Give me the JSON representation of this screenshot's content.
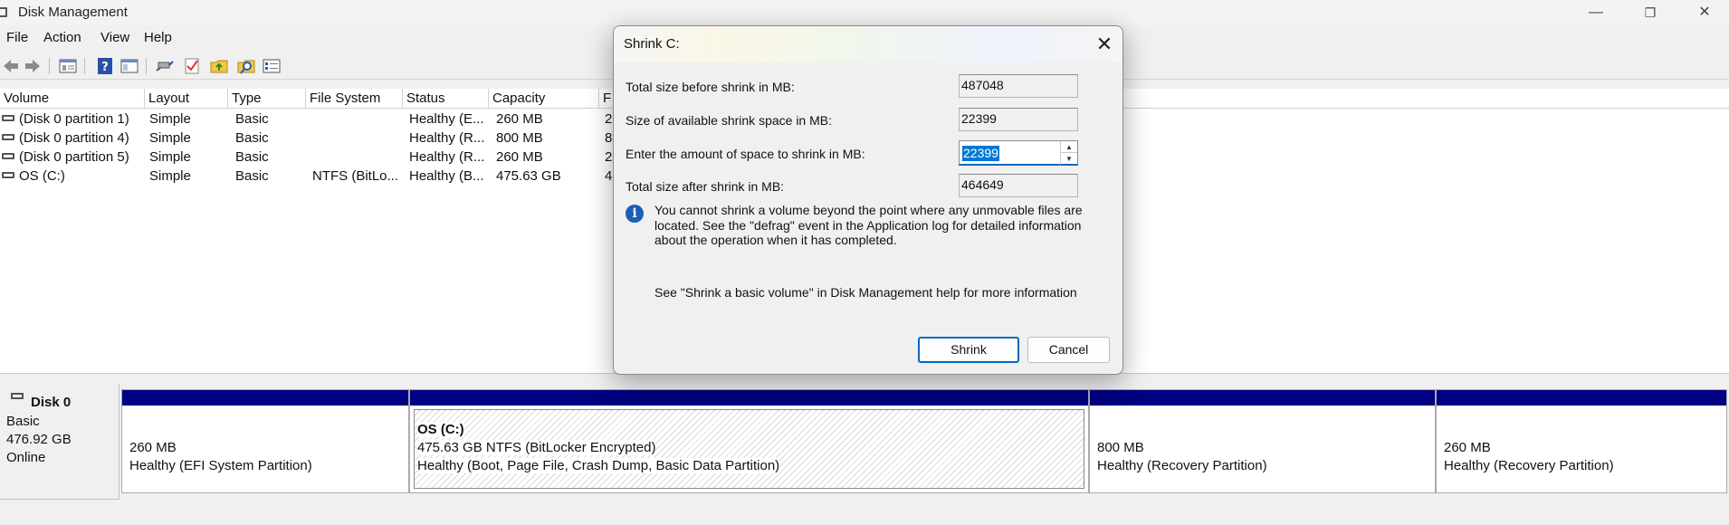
{
  "window": {
    "title": "Disk Management",
    "minimize": "—",
    "restore": "❐",
    "close": "✕"
  },
  "menu": {
    "items": [
      "File",
      "Action",
      "View",
      "Help"
    ]
  },
  "toolbar": {
    "icons": [
      "back-arrow-icon",
      "forward-arrow-icon",
      "properties-list-icon",
      "help-icon",
      "console-tree-icon",
      "connect-icon",
      "check-icon",
      "folder-up-icon",
      "search-folder-icon",
      "settings-list-icon"
    ]
  },
  "volume_list": {
    "columns": [
      "Volume",
      "Layout",
      "Type",
      "File System",
      "Status",
      "Capacity",
      "F"
    ],
    "rows": [
      {
        "volume": "(Disk 0 partition 1)",
        "layout": "Simple",
        "type": "Basic",
        "fs": "",
        "status": "Healthy (E...",
        "capacity": "260 MB",
        "free": "2"
      },
      {
        "volume": "(Disk 0 partition 4)",
        "layout": "Simple",
        "type": "Basic",
        "fs": "",
        "status": "Healthy (R...",
        "capacity": "800 MB",
        "free": "8"
      },
      {
        "volume": "(Disk 0 partition 5)",
        "layout": "Simple",
        "type": "Basic",
        "fs": "",
        "status": "Healthy (R...",
        "capacity": "260 MB",
        "free": "2"
      },
      {
        "volume": "OS (C:)",
        "layout": "Simple",
        "type": "Basic",
        "fs": "NTFS (BitLo...",
        "status": "Healthy (B...",
        "capacity": "475.63 GB",
        "free": "4"
      }
    ]
  },
  "disk": {
    "name": "Disk 0",
    "kind": "Basic",
    "size": "476.92 GB",
    "state": "Online",
    "partitions": [
      {
        "title": "",
        "line1": "260 MB",
        "line2": "Healthy (EFI System Partition)"
      },
      {
        "title": "OS  (C:)",
        "line1": "475.63 GB NTFS (BitLocker Encrypted)",
        "line2": "Healthy (Boot, Page File, Crash Dump, Basic Data Partition)"
      },
      {
        "title": "",
        "line1": "800 MB",
        "line2": "Healthy (Recovery Partition)"
      },
      {
        "title": "",
        "line1": "260 MB",
        "line2": "Healthy (Recovery Partition)"
      }
    ]
  },
  "dialog": {
    "title": "Shrink C:",
    "close": "✕",
    "labels": {
      "total_before": "Total size before shrink in MB:",
      "available": "Size of available shrink space in MB:",
      "amount": "Enter the amount of space to shrink in MB:",
      "total_after": "Total size after shrink in MB:"
    },
    "values": {
      "total_before": "487048",
      "available": "22399",
      "amount": "22399",
      "total_after": "464649"
    },
    "info": "You cannot shrink a volume beyond the point where any unmovable files are located. See the \"defrag\" event in the Application log for detailed information about the operation when it has completed.",
    "help": "See \"Shrink a basic volume\" in Disk Management help for more information",
    "shrink_label": "Shrink",
    "cancel_label": "Cancel",
    "spin_up": "▲",
    "spin_down": "▼",
    "info_glyph": "i"
  },
  "colors": {
    "partition_bar": "#000080",
    "accent": "#0067c0",
    "selection": "#0078d7",
    "info_icon": "#1a5fb4"
  }
}
